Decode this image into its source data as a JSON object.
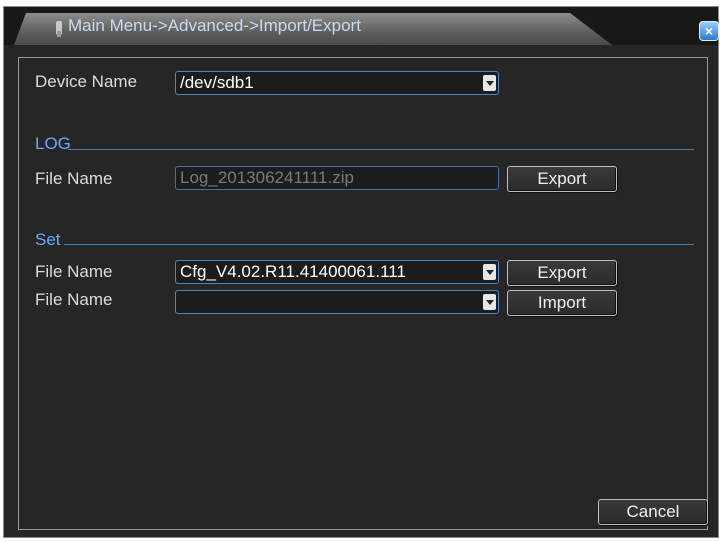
{
  "window": {
    "title": "Main Menu->Advanced->Import/Export",
    "close_label": "×"
  },
  "device": {
    "label": "Device Name",
    "value": "/dev/sdb1"
  },
  "log_section": {
    "heading": "LOG",
    "file_label": "File Name",
    "file_value": "Log_201306241111.zip",
    "export_label": "Export"
  },
  "set_section": {
    "heading": "Set",
    "export_row": {
      "file_label": "File Name",
      "file_value": "Cfg_V4.02.R11.41400061.111",
      "button_label": "Export"
    },
    "import_row": {
      "file_label": "File Name",
      "file_value": "",
      "button_label": "Import"
    }
  },
  "footer": {
    "cancel_label": "Cancel"
  },
  "colors": {
    "background": "#262626",
    "accent_blue": "#4f86c7",
    "section_text": "#6aa9ff"
  },
  "icons": [
    "usb-icon",
    "close-icon",
    "chevron-down-icon"
  ]
}
